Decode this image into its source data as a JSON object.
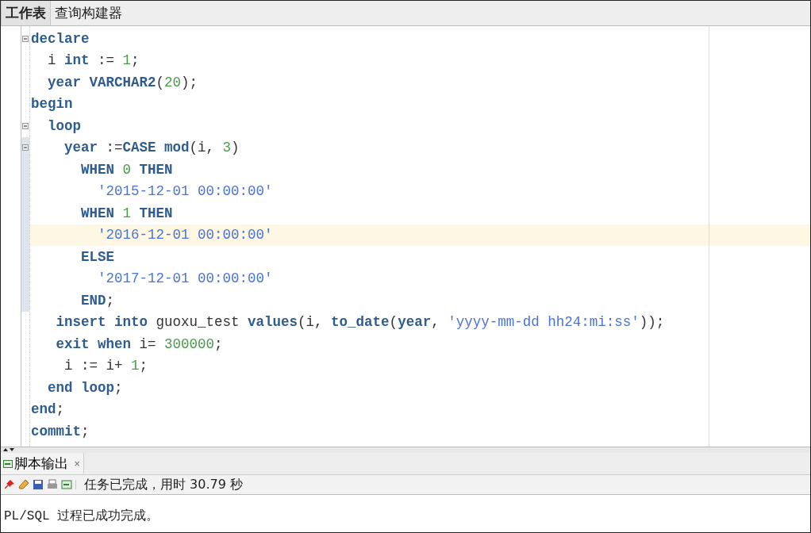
{
  "tabs": [
    {
      "label": "工作表",
      "selected": true
    },
    {
      "label": "查询构建器",
      "selected": false
    }
  ],
  "editor": {
    "lines": [
      {
        "fold": true,
        "changed": false,
        "highlighted": false,
        "tokens": [
          {
            "kind": "kw",
            "text": "declare"
          }
        ]
      },
      {
        "fold": false,
        "changed": false,
        "highlighted": false,
        "tokens": [
          {
            "kind": "plain",
            "text": "  i "
          },
          {
            "kind": "kw",
            "text": "int"
          },
          {
            "kind": "plain",
            "text": " := "
          },
          {
            "kind": "num",
            "text": "1"
          },
          {
            "kind": "plain",
            "text": ";"
          }
        ]
      },
      {
        "fold": false,
        "changed": false,
        "highlighted": false,
        "tokens": [
          {
            "kind": "kw",
            "text": "  year"
          },
          {
            "kind": "kw",
            "text": " VARCHAR2"
          },
          {
            "kind": "plain",
            "text": "("
          },
          {
            "kind": "num",
            "text": "20"
          },
          {
            "kind": "plain",
            "text": ");"
          }
        ]
      },
      {
        "fold": false,
        "changed": false,
        "highlighted": false,
        "tokens": [
          {
            "kind": "kw",
            "text": "begin"
          }
        ]
      },
      {
        "fold": true,
        "changed": false,
        "highlighted": false,
        "tokens": [
          {
            "kind": "kw",
            "text": "  loop"
          }
        ]
      },
      {
        "fold": true,
        "changed": true,
        "highlighted": false,
        "tokens": [
          {
            "kind": "kw",
            "text": "    year"
          },
          {
            "kind": "plain",
            "text": " :="
          },
          {
            "kind": "kw",
            "text": "CASE"
          },
          {
            "kind": "kw",
            "text": " mod"
          },
          {
            "kind": "plain",
            "text": "(i, "
          },
          {
            "kind": "num",
            "text": "3"
          },
          {
            "kind": "plain",
            "text": ")"
          }
        ]
      },
      {
        "fold": false,
        "changed": true,
        "highlighted": false,
        "tokens": [
          {
            "kind": "kw",
            "text": "      WHEN"
          },
          {
            "kind": "num",
            "text": " 0"
          },
          {
            "kind": "kw",
            "text": " THEN"
          }
        ]
      },
      {
        "fold": false,
        "changed": true,
        "highlighted": false,
        "tokens": [
          {
            "kind": "str",
            "text": "        '2015-12-01 00:00:00'"
          }
        ]
      },
      {
        "fold": false,
        "changed": true,
        "highlighted": false,
        "tokens": [
          {
            "kind": "kw",
            "text": "      WHEN"
          },
          {
            "kind": "num",
            "text": " 1"
          },
          {
            "kind": "kw",
            "text": " THEN"
          }
        ]
      },
      {
        "fold": false,
        "changed": true,
        "highlighted": true,
        "tokens": [
          {
            "kind": "str",
            "text": "        '2016-12-01 00:00:00'"
          }
        ]
      },
      {
        "fold": false,
        "changed": true,
        "highlighted": false,
        "tokens": [
          {
            "kind": "kw",
            "text": "      ELSE"
          }
        ]
      },
      {
        "fold": false,
        "changed": true,
        "highlighted": false,
        "tokens": [
          {
            "kind": "str",
            "text": "        '2017-12-01 00:00:00'"
          }
        ]
      },
      {
        "fold": false,
        "changed": true,
        "highlighted": false,
        "tokens": [
          {
            "kind": "kw",
            "text": "      END"
          },
          {
            "kind": "plain",
            "text": ";"
          }
        ]
      },
      {
        "fold": false,
        "changed": false,
        "highlighted": false,
        "tokens": [
          {
            "kind": "kw",
            "text": "   insert into"
          },
          {
            "kind": "plain",
            "text": " guoxu_test "
          },
          {
            "kind": "kw",
            "text": "values"
          },
          {
            "kind": "plain",
            "text": "(i, "
          },
          {
            "kind": "kw",
            "text": "to_date"
          },
          {
            "kind": "plain",
            "text": "("
          },
          {
            "kind": "kw",
            "text": "year"
          },
          {
            "kind": "plain",
            "text": ", "
          },
          {
            "kind": "str",
            "text": "'yyyy-mm-dd hh24:mi:ss'"
          },
          {
            "kind": "plain",
            "text": "));"
          }
        ]
      },
      {
        "fold": false,
        "changed": false,
        "highlighted": false,
        "tokens": [
          {
            "kind": "kw",
            "text": "   exit when"
          },
          {
            "kind": "plain",
            "text": " i= "
          },
          {
            "kind": "num",
            "text": "300000"
          },
          {
            "kind": "plain",
            "text": ";"
          }
        ]
      },
      {
        "fold": false,
        "changed": false,
        "highlighted": false,
        "tokens": [
          {
            "kind": "plain",
            "text": "    i := i+ "
          },
          {
            "kind": "num",
            "text": "1"
          },
          {
            "kind": "plain",
            "text": ";"
          }
        ]
      },
      {
        "fold": false,
        "changed": false,
        "highlighted": false,
        "tokens": [
          {
            "kind": "kw",
            "text": "  end loop"
          },
          {
            "kind": "plain",
            "text": ";"
          }
        ]
      },
      {
        "fold": false,
        "changed": false,
        "highlighted": false,
        "tokens": [
          {
            "kind": "kw",
            "text": "end"
          },
          {
            "kind": "plain",
            "text": ";"
          }
        ]
      },
      {
        "fold": false,
        "changed": false,
        "highlighted": false,
        "tokens": [
          {
            "kind": "kw",
            "text": "commit"
          },
          {
            "kind": "plain",
            "text": ";"
          }
        ]
      }
    ]
  },
  "output_panel": {
    "tab": {
      "label": "脚本输出",
      "close": "×"
    },
    "status": "任务已完成，用时 30.79 秒",
    "message": "PL/SQL 过程已成功完成。"
  }
}
